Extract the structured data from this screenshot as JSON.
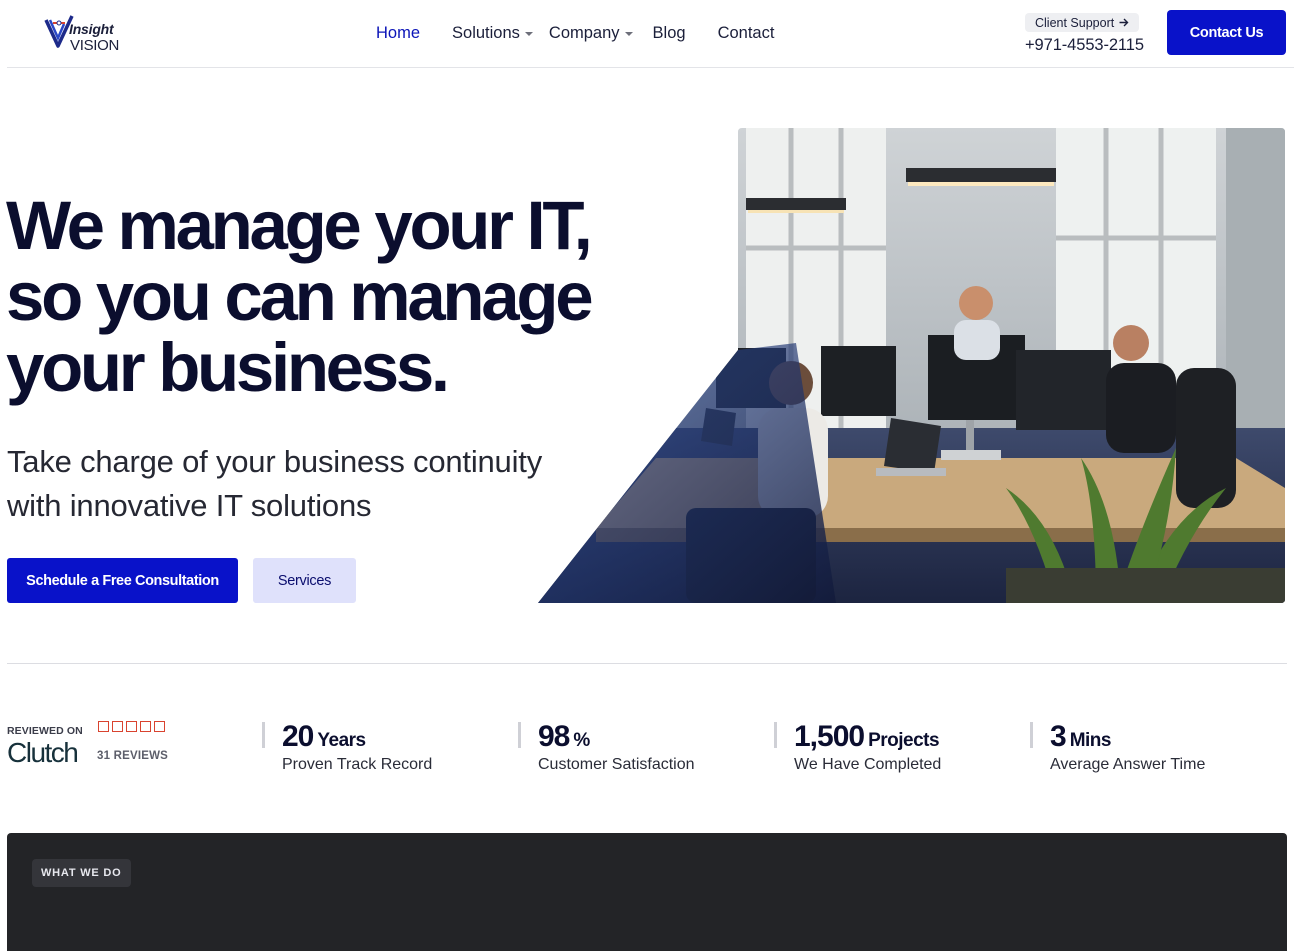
{
  "brand": {
    "logo_top": "Insight",
    "logo_bottom": "VISION",
    "accent": "#0912c9"
  },
  "nav": {
    "items": [
      {
        "label": "Home",
        "active": true,
        "dropdown": false
      },
      {
        "label": "Solutions",
        "active": false,
        "dropdown": true
      },
      {
        "label": "Company",
        "active": false,
        "dropdown": true
      },
      {
        "label": "Blog",
        "active": false,
        "dropdown": false
      },
      {
        "label": "Contact",
        "active": false,
        "dropdown": false
      }
    ]
  },
  "header": {
    "support_label": "Client Support",
    "support_icon": "arrow-right-icon",
    "phone": "+971-4553-2115",
    "contact_button": "Contact Us"
  },
  "hero": {
    "title_lines": [
      "We manage your IT,",
      "so you can manage",
      "your business."
    ],
    "subtitle_lines": [
      "Take charge of your business continuity",
      "with innovative IT solutions"
    ],
    "primary_cta": "Schedule a Free Consultation",
    "secondary_cta": "Services"
  },
  "clutch": {
    "reviewed_on": "REVIEWED ON",
    "brand": "Clutch",
    "star_count": 5,
    "reviews": "31 REVIEWS"
  },
  "stats": [
    {
      "value": "20",
      "unit": "Years",
      "label": "Proven Track Record"
    },
    {
      "value": "98",
      "unit": "%",
      "label": "Customer Satisfaction"
    },
    {
      "value": "1,500",
      "unit": "Projects",
      "label": "We Have Completed"
    },
    {
      "value": "3",
      "unit": "Mins",
      "label": "Average Answer Time"
    }
  ],
  "section": {
    "badge": "WHAT WE DO"
  }
}
